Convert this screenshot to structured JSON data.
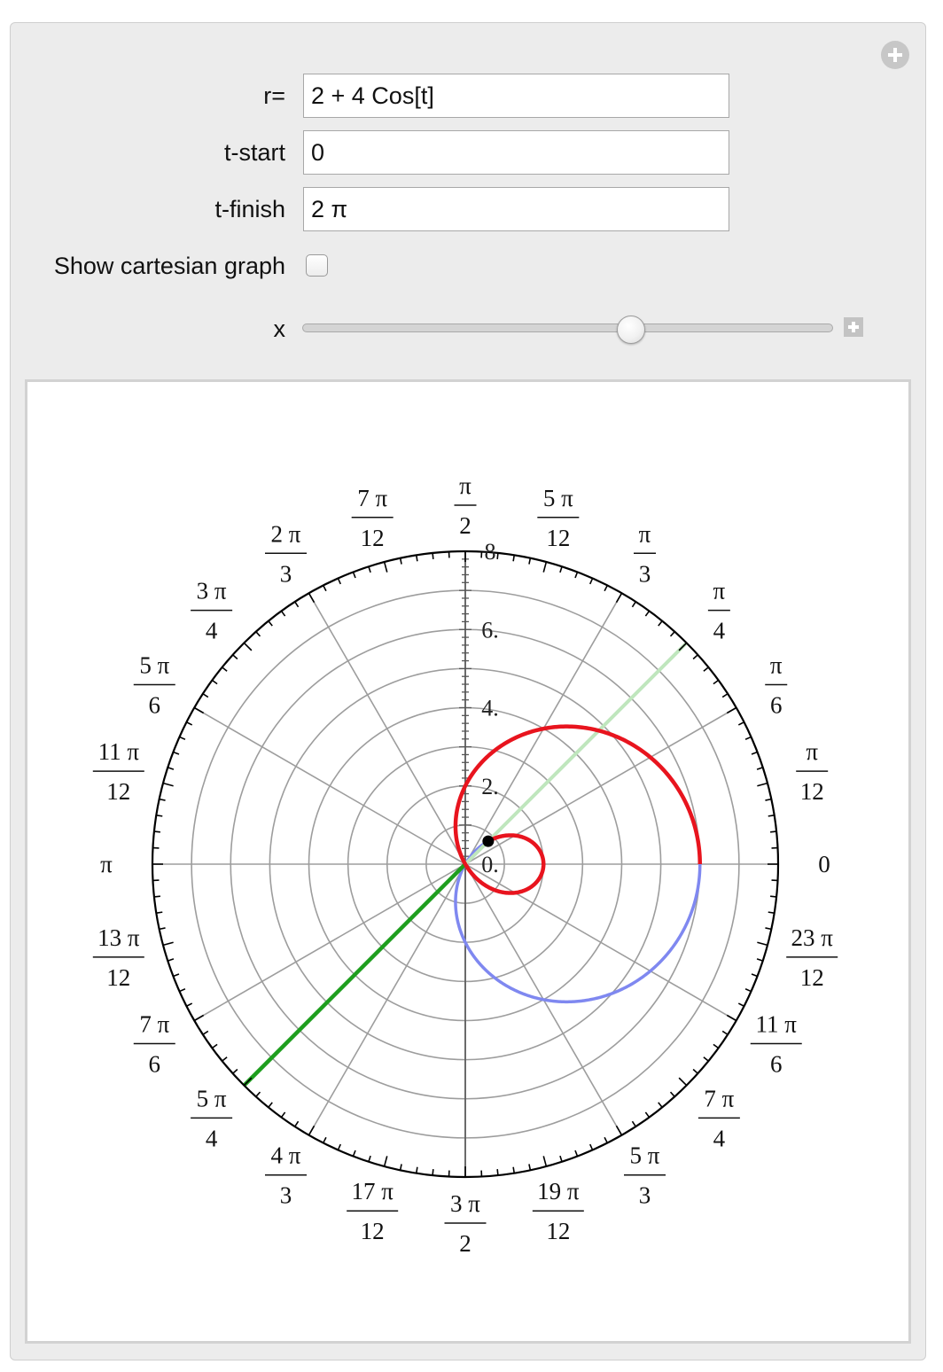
{
  "controls": {
    "r_label": "r=",
    "r_value": "2 + 4 Cos[t]",
    "tstart_label": "t-start",
    "tstart_value": "0",
    "tfinish_label": "t-finish",
    "tfinish_value": "2 π",
    "cartesian_label": "Show cartesian graph",
    "cartesian_checked": false,
    "slider_label": "x",
    "slider_fraction": 0.62
  },
  "chart_data": {
    "type": "polar",
    "function": "r = 2 + 4 Cos[t]",
    "t_range": [
      0,
      6.283185307
    ],
    "r_max": 8,
    "radial_ticks": [
      "0.",
      "2.",
      "4.",
      "6.",
      "8"
    ],
    "angle_labels": [
      {
        "num": "0",
        "den": ""
      },
      {
        "num": "π",
        "den": "12"
      },
      {
        "num": "π",
        "den": "6"
      },
      {
        "num": "π",
        "den": "4"
      },
      {
        "num": "π",
        "den": "3"
      },
      {
        "num": "5 π",
        "den": "12"
      },
      {
        "num": "π",
        "den": "2"
      },
      {
        "num": "7 π",
        "den": "12"
      },
      {
        "num": "2 π",
        "den": "3"
      },
      {
        "num": "3 π",
        "den": "4"
      },
      {
        "num": "5 π",
        "den": "6"
      },
      {
        "num": "11 π",
        "den": "12"
      },
      {
        "num": "π",
        "den": ""
      },
      {
        "num": "13 π",
        "den": "12"
      },
      {
        "num": "7 π",
        "den": "6"
      },
      {
        "num": "5 π",
        "den": "4"
      },
      {
        "num": "4 π",
        "den": "3"
      },
      {
        "num": "17 π",
        "den": "12"
      },
      {
        "num": "3 π",
        "den": "2"
      },
      {
        "num": "19 π",
        "den": "12"
      },
      {
        "num": "5 π",
        "den": "3"
      },
      {
        "num": "7 π",
        "den": "4"
      },
      {
        "num": "11 π",
        "den": "6"
      },
      {
        "num": "23 π",
        "den": "12"
      }
    ],
    "traced_angle": 3.927,
    "colors": {
      "traced_curve": "#e8141e",
      "untraced_curve": "#7f88f0",
      "ray_active": "#1e9e1e",
      "ray_opposite": "#bfe6bd",
      "grid": "#9d9d9d",
      "point": "#000000"
    }
  }
}
